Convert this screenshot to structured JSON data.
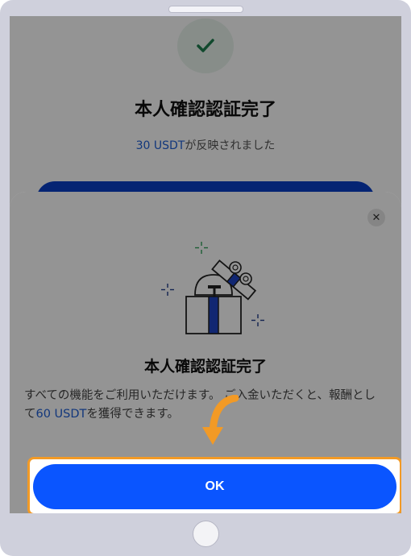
{
  "background": {
    "title": "本人確認認証完了",
    "subtitle_amount": "30 USDT",
    "subtitle_rest": "が反映されました"
  },
  "modal": {
    "title": "本人確認認証完了",
    "desc_part1": "すべての機能をご利用いただけます。 ご入金いただくと、報酬として",
    "desc_amount": "60 USDT",
    "desc_part2": "を獲得できます。",
    "ok_label": "OK",
    "close_symbol": "✕"
  },
  "colors": {
    "accent_blue": "#0a55ff",
    "highlight_orange": "#f29a26",
    "check_green": "#1e7f4f"
  }
}
